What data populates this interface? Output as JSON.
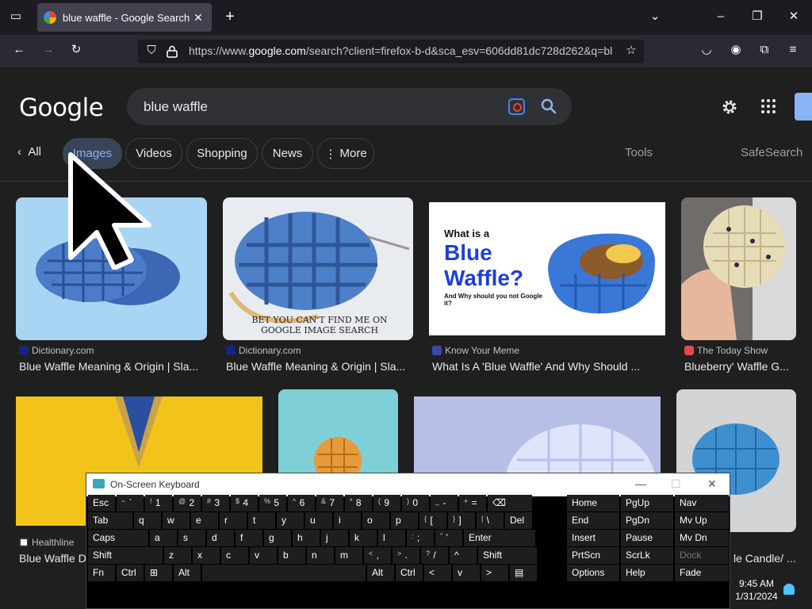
{
  "browser": {
    "tab_title": "blue waffle - Google Search",
    "url_prefix": "https://www.",
    "url_host": "google.com",
    "url_rest": "/search?client=firefox-b-d&sca_esv=606dd81dc728d262&q=bl"
  },
  "google": {
    "logo": "Google",
    "query": "blue waffle",
    "nav_all": "All",
    "tabs": [
      "Images",
      "Videos",
      "Shopping",
      "News",
      "More"
    ],
    "tools": "Tools",
    "safesearch": "SafeSearch"
  },
  "results": [
    {
      "source": "Dictionary.com",
      "title": "Blue Waffle Meaning & Origin | Sla..."
    },
    {
      "source": "Dictionary.com",
      "title": "Blue Waffle Meaning & Origin | Sla...",
      "overlay": "BET YOU CAN'T FIND ME ON GOOGLE IMAGE SEARCH"
    },
    {
      "source": "Know Your Meme",
      "title": "What Is A 'Blue Waffle' And Why Should ...",
      "overlay_small": "What is a",
      "overlay_big": "Blue Waffle?",
      "overlay_sub": "And Why should you not Google it?"
    },
    {
      "source": "The Today Show",
      "title": "Blueberry' Waffle G..."
    },
    {
      "source": "Healthline",
      "title": "Blue Waffle D..."
    },
    {
      "source": "",
      "title": "le Candle/ ..."
    }
  ],
  "keyboard": {
    "title": "On-Screen Keyboard",
    "rows": [
      [
        "Esc",
        "~ `",
        "! 1",
        "@ 2",
        "# 3",
        "$ 4",
        "% 5",
        "^ 6",
        "& 7",
        "* 8",
        "( 9",
        ") 0",
        "_ -",
        "+ =",
        "⌫"
      ],
      [
        "Tab",
        "q",
        "w",
        "e",
        "r",
        "t",
        "y",
        "u",
        "i",
        "o",
        "p",
        "{ [",
        "} ]",
        "| \\",
        "Del"
      ],
      [
        "Caps",
        "a",
        "s",
        "d",
        "f",
        "g",
        "h",
        "j",
        "k",
        "l",
        ": ;",
        "\" '",
        "Enter"
      ],
      [
        "Shift",
        "z",
        "x",
        "c",
        "v",
        "b",
        "n",
        "m",
        "< ,",
        "> .",
        "? /",
        "^",
        "Shift"
      ],
      [
        "Fn",
        "Ctrl",
        "⊞",
        "Alt",
        "",
        "Alt",
        "Ctrl",
        "<",
        "v",
        ">",
        "▤"
      ]
    ],
    "nav_keys": [
      [
        "Home",
        "PgUp",
        "Nav"
      ],
      [
        "End",
        "PgDn",
        "Mv Up"
      ],
      [
        "Insert",
        "Pause",
        "Mv Dn"
      ],
      [
        "PrtScn",
        "ScrLk",
        "Dock"
      ],
      [
        "Options",
        "Help",
        "Fade"
      ]
    ]
  },
  "taskbar": {
    "time": "9:45 AM",
    "date": "1/31/2024"
  },
  "colors": {
    "accent": "#8ab4f8",
    "chip_selected_bg": "#394457",
    "page_bg": "#1f1f1f"
  }
}
